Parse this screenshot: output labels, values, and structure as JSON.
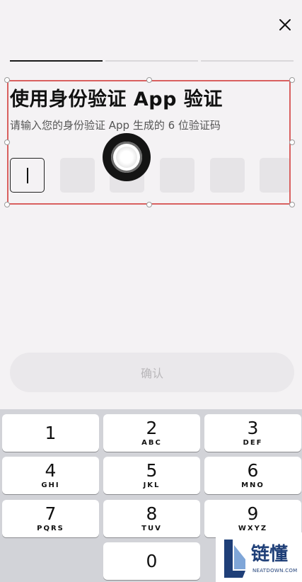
{
  "header": {
    "close_icon": "close-icon"
  },
  "progress": {
    "total_steps": 3,
    "current_step": 1
  },
  "auth": {
    "title": "使用身份验证 App 验证",
    "subtitle": "请输入您的身份验证 App 生成的 6 位验证码",
    "code_length": 6,
    "code_value": ""
  },
  "confirm_button": {
    "label": "确认"
  },
  "keypad": {
    "keys": [
      {
        "number": "1",
        "letters": ""
      },
      {
        "number": "2",
        "letters": "ABC"
      },
      {
        "number": "3",
        "letters": "DEF"
      },
      {
        "number": "4",
        "letters": "GHI"
      },
      {
        "number": "5",
        "letters": "JKL"
      },
      {
        "number": "6",
        "letters": "MNO"
      },
      {
        "number": "7",
        "letters": "PQRS"
      },
      {
        "number": "8",
        "letters": "TUV"
      },
      {
        "number": "9",
        "letters": "WXYZ"
      },
      {
        "number": "0",
        "letters": ""
      }
    ]
  },
  "watermark": {
    "title": "链懂",
    "subtitle": "NEATDOWN.COM"
  },
  "colors": {
    "selection_border": "#d9605f",
    "brand": "#1f3f78"
  }
}
